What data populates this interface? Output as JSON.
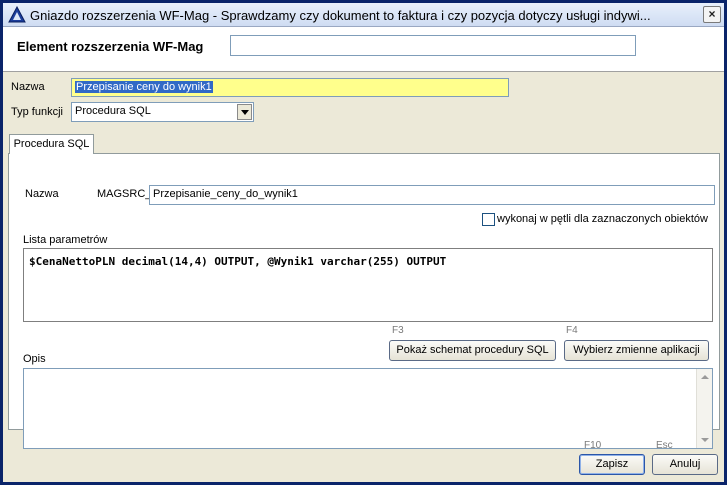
{
  "window": {
    "title": "Gniazdo rozszerzenia WF-Mag - Sprawdzamy czy dokument to faktura i czy pozycja dotyczy usługi indywi...",
    "close_label": "×"
  },
  "header": {
    "label": "Element rozszerzenia WF-Mag",
    "value": ""
  },
  "form": {
    "name_label": "Nazwa",
    "name_value": "Przepisanie ceny do wynik1",
    "type_label": "Typ funkcji",
    "type_value": "Procedura SQL"
  },
  "tabs": [
    {
      "label": "Procedura SQL",
      "active": true
    }
  ],
  "procedure": {
    "name_label": "Nazwa",
    "prefix": "MAGSRC_",
    "name_value": "Przepisanie_ceny_do_wynik1",
    "loop_checkbox_label": "wykonaj w pętli dla zaznaczonych obiektów",
    "loop_checked": false,
    "params_label": "Lista parametrów",
    "params_value": "$CenaNettoPLN decimal(14,4) OUTPUT, @Wynik1 varchar(255) OUTPUT",
    "schema_fkey": "F3",
    "schema_button": "Pokaż schemat procedury SQL",
    "vars_fkey": "F4",
    "vars_button": "Wybierz zmienne aplikacji",
    "desc_label": "Opis",
    "desc_value": ""
  },
  "footer": {
    "save_fkey": "F10",
    "save_button": "Zapisz",
    "cancel_fkey": "Esc",
    "cancel_button": "Anuluj"
  },
  "colors": {
    "title_accent": "#0a246a",
    "name_highlight": "#ffff8c",
    "selection": "#3169c6"
  }
}
